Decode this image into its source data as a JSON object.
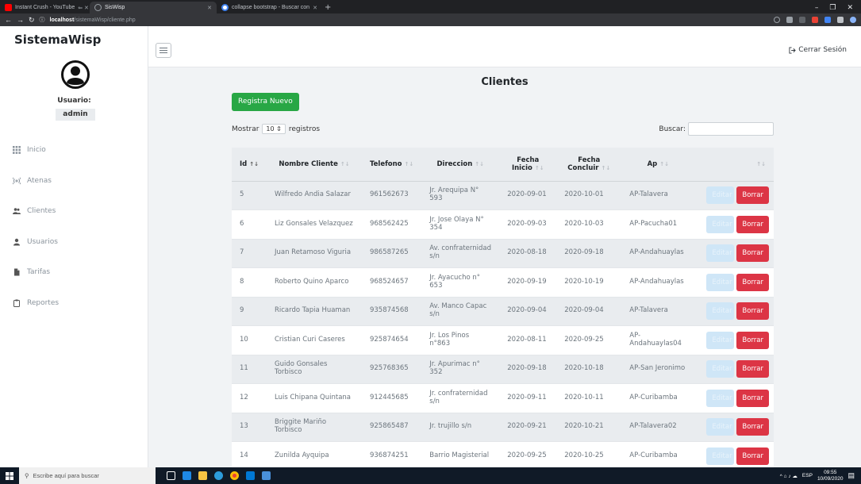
{
  "browser": {
    "tabs": [
      {
        "label": "Instant Crush - YouTube",
        "favicon_color": "#ff0000"
      },
      {
        "label": "SisWisp",
        "favicon_color": "#9aa0a6"
      },
      {
        "label": "collapse bootstrap - Buscar con",
        "favicon_color": "#4285f4"
      }
    ],
    "new_tab": "+",
    "url_host": "localhost",
    "url_path": "/sistemaWisp/cliente.php"
  },
  "sidebar": {
    "brand": "SistemaWisp",
    "user_label": "Usuario:",
    "username": "admin",
    "items": [
      {
        "label": "Inicio",
        "icon": "grid-icon"
      },
      {
        "label": "Atenas",
        "icon": "wifi-icon"
      },
      {
        "label": "Clientes",
        "icon": "users-icon"
      },
      {
        "label": "Usuarios",
        "icon": "user-icon"
      },
      {
        "label": "Tarifas",
        "icon": "file-icon"
      },
      {
        "label": "Reportes",
        "icon": "clipboard-icon"
      }
    ]
  },
  "header": {
    "logout": "Cerrar Sesión"
  },
  "main": {
    "title": "Clientes",
    "new_button": "Registra Nuevo",
    "length_prefix": "Mostrar",
    "length_value": "10",
    "length_suffix": "registros",
    "search_label": "Buscar:",
    "columns": [
      "Id",
      "Nombre Cliente",
      "Telefono",
      "Direccion",
      "Fecha Inicio",
      "Fecha Concluir",
      "Ap",
      ""
    ],
    "edit_label": "Editar",
    "delete_label": "Borrar",
    "rows": [
      [
        "5",
        "Wilfredo Andia Salazar",
        "961562673",
        "Jr. Arequipa N° 593",
        "2020-09-01",
        "2020-10-01",
        "AP-Talavera"
      ],
      [
        "6",
        "Liz Gonsales Velazquez",
        "968562425",
        "Jr. Jose Olaya N° 354",
        "2020-09-03",
        "2020-10-03",
        "AP-Pacucha01"
      ],
      [
        "7",
        "Juan Retamoso Viguria",
        "986587265",
        "Av. confraternidad s/n",
        "2020-08-18",
        "2020-09-18",
        "AP-Andahuaylas"
      ],
      [
        "8",
        "Roberto Quino Aparco",
        "968524657",
        "Jr. Ayacucho n° 653",
        "2020-09-19",
        "2020-10-19",
        "AP-Andahuaylas"
      ],
      [
        "9",
        "Ricardo Tapia Huaman",
        "935874568",
        "Av. Manco Capac s/n",
        "2020-09-04",
        "2020-09-04",
        "AP-Talavera"
      ],
      [
        "10",
        "Cristian Curi Caseres",
        "925874654",
        "Jr. Los Pinos n°863",
        "2020-08-11",
        "2020-09-25",
        "AP-Andahuaylas04"
      ],
      [
        "11",
        "Guido Gonsales Torbisco",
        "925768365",
        "Jr. Apurimac n° 352",
        "2020-09-18",
        "2020-10-18",
        "AP-San Jeronimo"
      ],
      [
        "12",
        "Luis Chipana Quintana",
        "912445685",
        "Jr. confraternidad s/n",
        "2020-09-11",
        "2020-10-11",
        "AP-Curibamba"
      ],
      [
        "13",
        "Briggite Mariño Torbisco",
        "925865487",
        "Jr. trujillo s/n",
        "2020-09-21",
        "2020-10-21",
        "AP-Talavera02"
      ],
      [
        "14",
        "Zunilda Ayquipa",
        "936874251",
        "Barrio Magisterial",
        "2020-09-25",
        "2020-10-25",
        "AP-Curibamba"
      ]
    ]
  },
  "taskbar": {
    "search_placeholder": "Escribe aquí para buscar",
    "lang": "ESP",
    "time": "09:55",
    "date": "10/09/2020"
  }
}
